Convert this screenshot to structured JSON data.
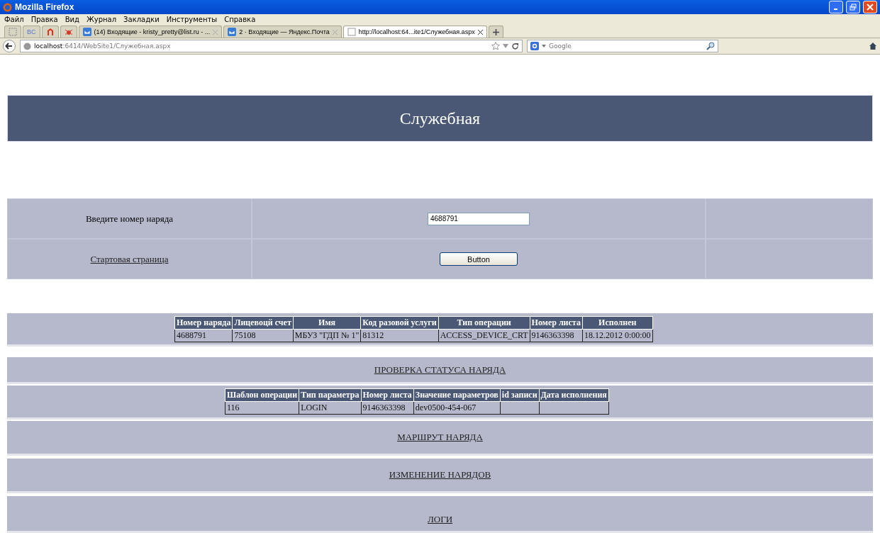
{
  "window": {
    "title": "Mozilla Firefox"
  },
  "menu": [
    "Файл",
    "Правка",
    "Вид",
    "Журнал",
    "Закладки",
    "Инструменты",
    "Справка"
  ],
  "tabs": [
    {
      "kind": "app",
      "selected": false
    },
    {
      "kind": "text",
      "label": "BC",
      "selected": false
    },
    {
      "kind": "logo",
      "selected": false
    },
    {
      "kind": "bug",
      "selected": false
    },
    {
      "kind": "page",
      "label": "(14) Входящие - kristy_pretty@list.ru - ...",
      "selected": false
    },
    {
      "kind": "page",
      "label": "2 · Входящие — Яндекс.Почта",
      "selected": false
    },
    {
      "kind": "page",
      "label": "http://localhost:64...ite1/Служебная.aspx",
      "selected": true
    }
  ],
  "address": {
    "host": "localhost",
    "rest": ":6414/WebSite1/Служебная.aspx"
  },
  "search": {
    "placeholder": "Google"
  },
  "page": {
    "heading": "Служебная",
    "form": {
      "label": "Введите номер наряда",
      "value": "4688791",
      "link": "Стартовая страница",
      "button": "Button"
    },
    "orders_table": {
      "columns": [
        "Номер наряда",
        "Лицевоцй счет",
        "Имя",
        "Код разовой услуги",
        "Тип операции",
        "Номер листа",
        "Исполнен"
      ],
      "rows": [
        [
          "4688791",
          "75108",
          "МБУЗ \"ГДП № 1\"",
          "81312",
          "ACCESS_DEVICE_CRT",
          "9146363398",
          "18.12.2012 0:00:00"
        ]
      ]
    },
    "status_link": "ПРОВЕРКА СТАТУСА НАРЯДА",
    "params_table": {
      "columns": [
        "Шаблон операции",
        "Тип параметра",
        "Номер листа",
        "Значение параметров",
        "id записи",
        "Дата исполнения"
      ],
      "rows": [
        [
          "116",
          "LOGIN",
          "9146363398",
          "dev0500-454-067",
          "",
          ""
        ]
      ]
    },
    "sections": [
      {
        "link": "МАРШРУТ НАРЯДА"
      },
      {
        "link": "ИЗМЕНЕНИЕ НАРЯДОВ"
      },
      {
        "link": "ЛОГИ"
      }
    ]
  }
}
